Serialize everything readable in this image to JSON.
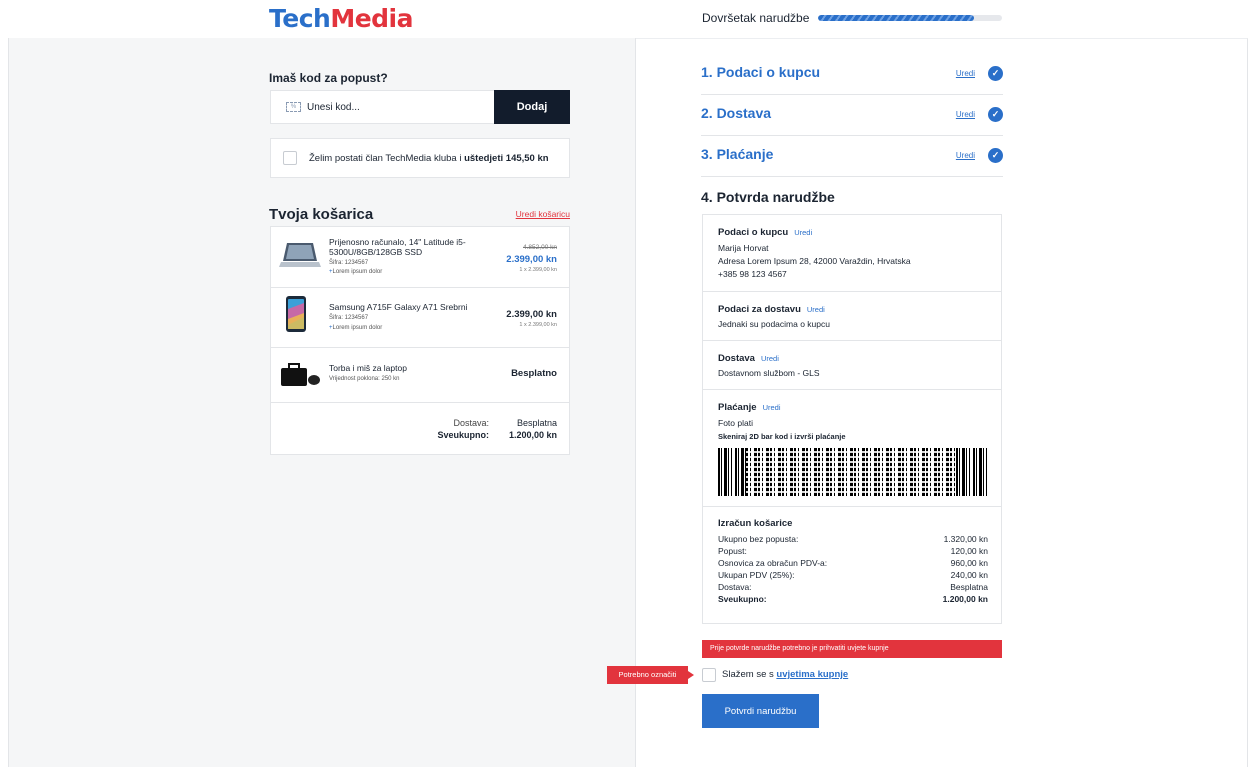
{
  "header": {
    "logo_part1": "Tech",
    "logo_part2": "Media",
    "progress_label": "Dovršetak narudžbe",
    "progress_value": 0.85
  },
  "discount": {
    "title": "Imaš kod za popust?",
    "placeholder": "Unesi kod...",
    "button": "Dodaj"
  },
  "club": {
    "text_before": "Želim postati član TechMedia kluba i ",
    "text_bold": "uštedjeti 145,50 kn"
  },
  "cart": {
    "title": "Tvoja košarica",
    "edit_link": "Uredi košaricu",
    "items": [
      {
        "name": "Prijenosno računalo, 14\" Latitude i5-5300U/8GB/128GB SSD",
        "sku": "Šifra: 1234567",
        "extra_plus": "+",
        "extra": "Lorem ipsum dolor",
        "price_old": "4.852,00 kn",
        "price": "2.399,00 kn",
        "unit": "1 x 2.399,00 kn"
      },
      {
        "name": "Samsung A715F Galaxy A71 Srebrni",
        "sku": "Šifra: 1234567",
        "extra_plus": "+",
        "extra": "Lorem ipsum dolor",
        "price": "2.399,00 kn",
        "unit": "1 x 2.399,00 kn"
      },
      {
        "name": "Torba i miš za laptop",
        "sku": "Vrijednost poklona: 250 kn",
        "price": "Besplatno"
      }
    ],
    "summary": {
      "shipping_label": "Dostava:",
      "shipping_value": "Besplatna",
      "total_label": "Sveukupno:",
      "total_value": "1.200,00 kn"
    }
  },
  "steps": [
    {
      "title": "1. Podaci o kupcu",
      "edit": "Uredi"
    },
    {
      "title": "2. Dostava",
      "edit": "Uredi"
    },
    {
      "title": "3. Plaćanje",
      "edit": "Uredi"
    }
  ],
  "confirm": {
    "title": "4. Potvrda narudžbe",
    "customer": {
      "title": "Podaci o kupcu",
      "edit": "Uredi",
      "name": "Marija Horvat",
      "address": "Adresa Lorem Ipsum 28, 42000 Varaždin, Hrvatska",
      "phone": "+385 98 123 4567"
    },
    "delivery_data": {
      "title": "Podaci za dostavu",
      "edit": "Uredi",
      "text": "Jednaki su podacima o kupcu"
    },
    "delivery": {
      "title": "Dostava",
      "edit": "Uredi",
      "text": "Dostavnom službom - GLS"
    },
    "payment": {
      "title": "Plaćanje",
      "edit": "Uredi",
      "method": "Foto plati",
      "scan_note": "Skeniraj 2D bar kod i izvrši plaćanje"
    },
    "calc": {
      "title": "Izračun košarice",
      "rows": [
        {
          "k": "Ukupno bez popusta:",
          "v": "1.320,00 kn"
        },
        {
          "k": "Popust:",
          "v": "120,00 kn"
        },
        {
          "k": "Osnovica za obračun PDV-a:",
          "v": "960,00 kn"
        },
        {
          "k": "Ukupan PDV (25%):",
          "v": "240,00 kn"
        },
        {
          "k": "Dostava:",
          "v": "Besplatna"
        },
        {
          "k": "Sveukupno:",
          "v": "1.200,00 kn"
        }
      ]
    }
  },
  "terms": {
    "alert": "Prije potvrde narudžbe potrebno je prihvatiti uvjete kupnje",
    "required_tag": "Potrebno označiti",
    "text": "Slažem se s ",
    "link": "uvjetima kupnje",
    "button": "Potvrdi narudžbu"
  },
  "colors": {
    "accent_blue": "#2a6fc9",
    "accent_red": "#e2343d",
    "dark": "#121c2c"
  }
}
